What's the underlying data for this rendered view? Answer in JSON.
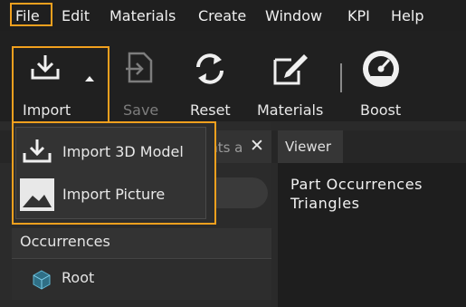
{
  "menu": {
    "items": [
      "File",
      "Edit",
      "Materials",
      "Create",
      "Window",
      "KPI",
      "Help"
    ]
  },
  "toolbar": {
    "import_label": "Import",
    "save_label": "Save",
    "reset_label": "Reset",
    "materials_label": "Materials",
    "boost_label": "Boost"
  },
  "dropdown": {
    "items": [
      "Import 3D Model",
      "Import Picture"
    ]
  },
  "left_panel": {
    "tab_title": "ants a",
    "occurrences_label": "Occurrences",
    "root_label": "Root"
  },
  "viewer": {
    "tab_label": "Viewer",
    "lines": [
      "Part Occurrences",
      "Triangles"
    ]
  },
  "colors": {
    "highlight": "#f1a01e",
    "background": "#2a2a2a",
    "menubar": "#1f1f1f"
  }
}
